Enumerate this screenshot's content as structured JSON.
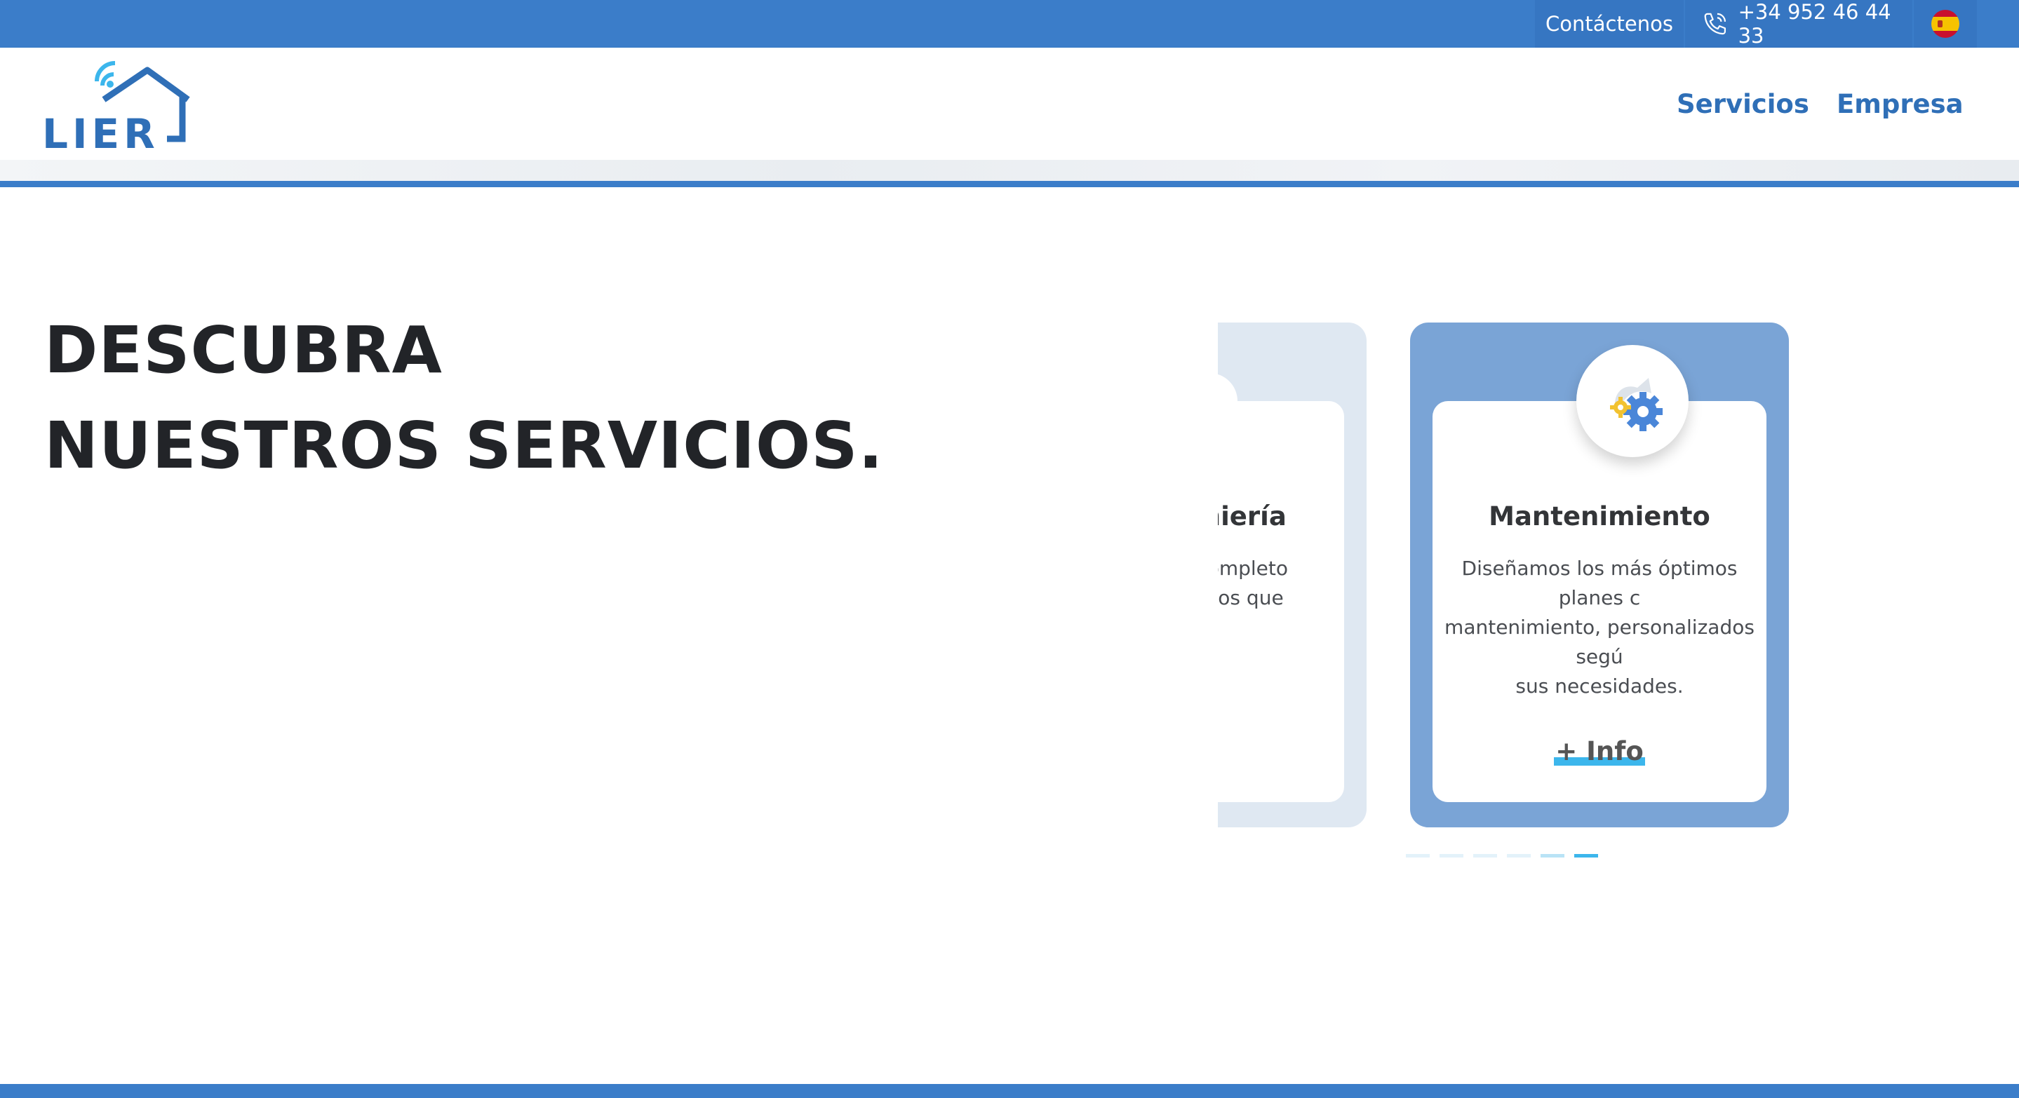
{
  "topbar": {
    "contact_label": "Contáctenos",
    "phone": "+34 952 46 44 33",
    "language_icon": "spain-flag-icon"
  },
  "header": {
    "logo_text": "LIER",
    "nav": [
      {
        "label": "Servicios"
      },
      {
        "label": "Empresa"
      }
    ]
  },
  "hero": {
    "line1": "DESCUBRA",
    "line2": "NUESTROS SERVICIOS."
  },
  "carousel": {
    "cards": [
      {
        "title": "geniería",
        "text": "ría completo\n; en los que"
      },
      {
        "title": "Mantenimiento",
        "text": "Diseñamos los más óptimos planes c\nmantenimiento, personalizados segú\nsus necesidades.",
        "link_label": "+ Info",
        "icon": "gears-icon"
      }
    ],
    "dots_count": 6,
    "active_dot": 6
  },
  "colors": {
    "brand_blue": "#3b7dc9",
    "card_blue": "#7aa4d6",
    "card_light": "#dfe8f2",
    "accent_cyan": "#3cb6ec",
    "heading": "#222428"
  }
}
